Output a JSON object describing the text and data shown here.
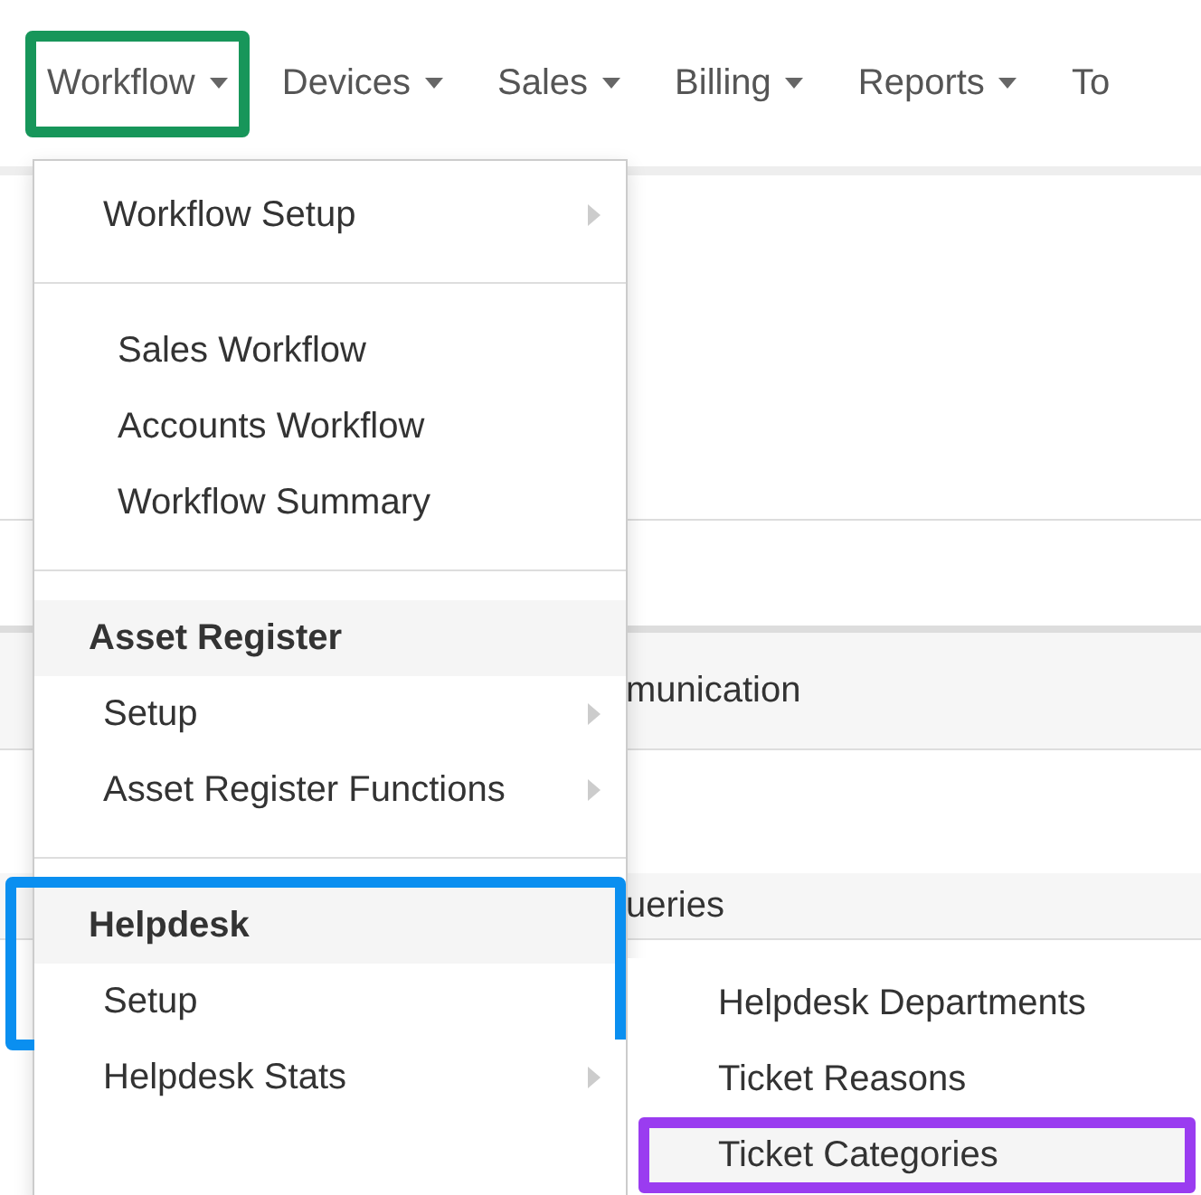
{
  "nav": {
    "items": [
      {
        "label": "Workflow",
        "caret": true,
        "color": "#17965a"
      },
      {
        "label": "Devices",
        "caret": true
      },
      {
        "label": "Sales",
        "caret": true
      },
      {
        "label": "Billing",
        "caret": true
      },
      {
        "label": "Reports",
        "caret": true
      },
      {
        "label": "To",
        "caret": false
      }
    ]
  },
  "background": {
    "rows": [
      {
        "text": "munication"
      },
      {
        "text": "ueries"
      }
    ]
  },
  "menu": {
    "sections": [
      {
        "items": [
          {
            "kind": "item",
            "label": "Workflow Setup",
            "submenu": true
          }
        ]
      },
      {
        "items": [
          {
            "kind": "indented",
            "label": "Sales Workflow",
            "submenu": false
          },
          {
            "kind": "indented",
            "label": "Accounts Workflow",
            "submenu": false
          },
          {
            "kind": "indented",
            "label": "Workflow Summary",
            "submenu": false
          }
        ]
      },
      {
        "items": [
          {
            "kind": "header",
            "label": "Asset Register"
          },
          {
            "kind": "item",
            "label": "Setup",
            "submenu": true
          },
          {
            "kind": "item",
            "label": "Asset Register Functions",
            "submenu": true
          }
        ]
      },
      {
        "color": "#0a8ff0",
        "items": [
          {
            "kind": "header",
            "label": "Helpdesk",
            "highlighted": true
          },
          {
            "kind": "item",
            "label": "Setup",
            "submenu": false,
            "highlighted": true
          },
          {
            "kind": "item",
            "label": "Helpdesk Stats",
            "submenu": true,
            "highlighted": false
          }
        ]
      }
    ]
  },
  "submenu": {
    "items": [
      {
        "label": "Helpdesk Departments"
      },
      {
        "label": "Ticket Reasons"
      },
      {
        "label": "Ticket Categories",
        "color": "#9a3cf0"
      }
    ]
  }
}
